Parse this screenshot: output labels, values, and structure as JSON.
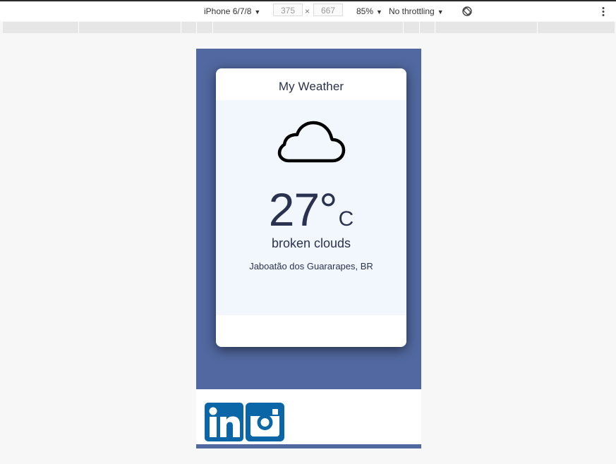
{
  "devtools": {
    "device_label": "iPhone 6/7/8",
    "width_value": "375",
    "times": "×",
    "height_value": "667",
    "zoom_label": "85%",
    "throttling_label": "No throttling",
    "caret": "▼"
  },
  "app": {
    "title": "My Weather",
    "weather_icon": "cloud-icon",
    "temperature": "27°",
    "unit": "C",
    "description": "broken clouds",
    "location": "Jaboatão dos Guararapes, BR"
  },
  "footer": {
    "links": [
      {
        "icon": "linkedin-icon",
        "color": "#0a66a7"
      },
      {
        "icon": "instagram-icon",
        "color": "#0a66a7"
      }
    ]
  },
  "colors": {
    "phone_background": "#5168a0",
    "card_body": "#f2f7fe",
    "text": "#2b3250",
    "social": "#0a66a7"
  }
}
